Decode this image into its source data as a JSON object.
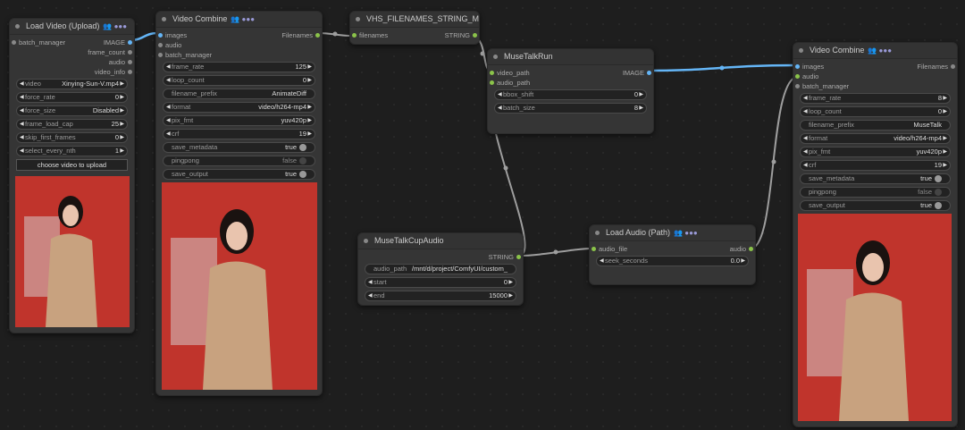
{
  "nodes": {
    "load_video": {
      "title": "Load Video (Upload)",
      "badge": "👥 ●●●",
      "inputs": [
        "batch_manager"
      ],
      "outputs": [
        "IMAGE",
        "frame_count",
        "audio",
        "video_info"
      ],
      "widgets": [
        {
          "label": "video",
          "value": "Xinying-Sun-V.mp4"
        },
        {
          "label": "force_rate",
          "value": "0"
        },
        {
          "label": "force_size",
          "value": "Disabled"
        },
        {
          "label": "frame_load_cap",
          "value": "25"
        },
        {
          "label": "skip_first_frames",
          "value": "0"
        },
        {
          "label": "select_every_nth",
          "value": "1"
        }
      ],
      "upload_button": "choose video to upload"
    },
    "video_combine_1": {
      "title": "Video Combine",
      "badge": "👥 ●●●",
      "inputs": [
        "images",
        "audio",
        "batch_manager"
      ],
      "output": "Filenames",
      "widgets": [
        {
          "label": "frame_rate",
          "value": "125",
          "kind": "num"
        },
        {
          "label": "loop_count",
          "value": "0",
          "kind": "num"
        },
        {
          "label": "filename_prefix",
          "value": "AnimateDiff",
          "kind": "text"
        },
        {
          "label": "format",
          "value": "video/h264-mp4",
          "kind": "num"
        },
        {
          "label": "pix_fmt",
          "value": "yuv420p",
          "kind": "num"
        },
        {
          "label": "crf",
          "value": "19",
          "kind": "num"
        },
        {
          "label": "save_metadata",
          "value": "true",
          "kind": "toggle"
        },
        {
          "label": "pingpong",
          "value": "false",
          "kind": "toggle"
        },
        {
          "label": "save_output",
          "value": "true",
          "kind": "toggle"
        }
      ]
    },
    "vhs_filenames": {
      "title": "VHS_FILENAMES_STRING_MuseTalk",
      "input": "filenames",
      "output": "STRING"
    },
    "musetalk_run": {
      "title": "MuseTalkRun",
      "inputs": [
        "video_path",
        "audio_path"
      ],
      "output": "IMAGE",
      "widgets": [
        {
          "label": "bbox_shift",
          "value": "0"
        },
        {
          "label": "batch_size",
          "value": "8"
        }
      ]
    },
    "musetalk_cup_audio": {
      "title": "MuseTalkCupAudio",
      "output": "STRING",
      "widgets": [
        {
          "label": "audio_path",
          "value": "/mnt/d/project/ComfyUI/custom_",
          "kind": "text"
        },
        {
          "label": "start",
          "value": "0",
          "kind": "num"
        },
        {
          "label": "end",
          "value": "15000",
          "kind": "num"
        }
      ]
    },
    "load_audio": {
      "title": "Load Audio (Path)",
      "badge": "👥 ●●●",
      "input": "audio_file",
      "output": "audio",
      "widgets": [
        {
          "label": "seek_seconds",
          "value": "0.0"
        }
      ]
    },
    "video_combine_2": {
      "title": "Video Combine",
      "badge": "👥 ●●●",
      "inputs": [
        "images",
        "audio",
        "batch_manager"
      ],
      "output": "Filenames",
      "widgets": [
        {
          "label": "frame_rate",
          "value": "8",
          "kind": "num"
        },
        {
          "label": "loop_count",
          "value": "0",
          "kind": "num"
        },
        {
          "label": "filename_prefix",
          "value": "MuseTalk",
          "kind": "text"
        },
        {
          "label": "format",
          "value": "video/h264-mp4",
          "kind": "num"
        },
        {
          "label": "pix_fmt",
          "value": "yuv420p",
          "kind": "num"
        },
        {
          "label": "crf",
          "value": "19",
          "kind": "num"
        },
        {
          "label": "save_metadata",
          "value": "true",
          "kind": "toggle"
        },
        {
          "label": "pingpong",
          "value": "false",
          "kind": "toggle"
        },
        {
          "label": "save_output",
          "value": "true",
          "kind": "toggle"
        }
      ]
    }
  },
  "colors": {
    "canvas": "#1e1e1e",
    "node": "#353535",
    "image_wire": "#64b5f6",
    "generic_wire": "#9e9e9e",
    "string_slot": "#8bc34a",
    "image_slot": "#64b5f6",
    "audio_slot": "#8bc34a",
    "empty_slot": "#888888"
  }
}
